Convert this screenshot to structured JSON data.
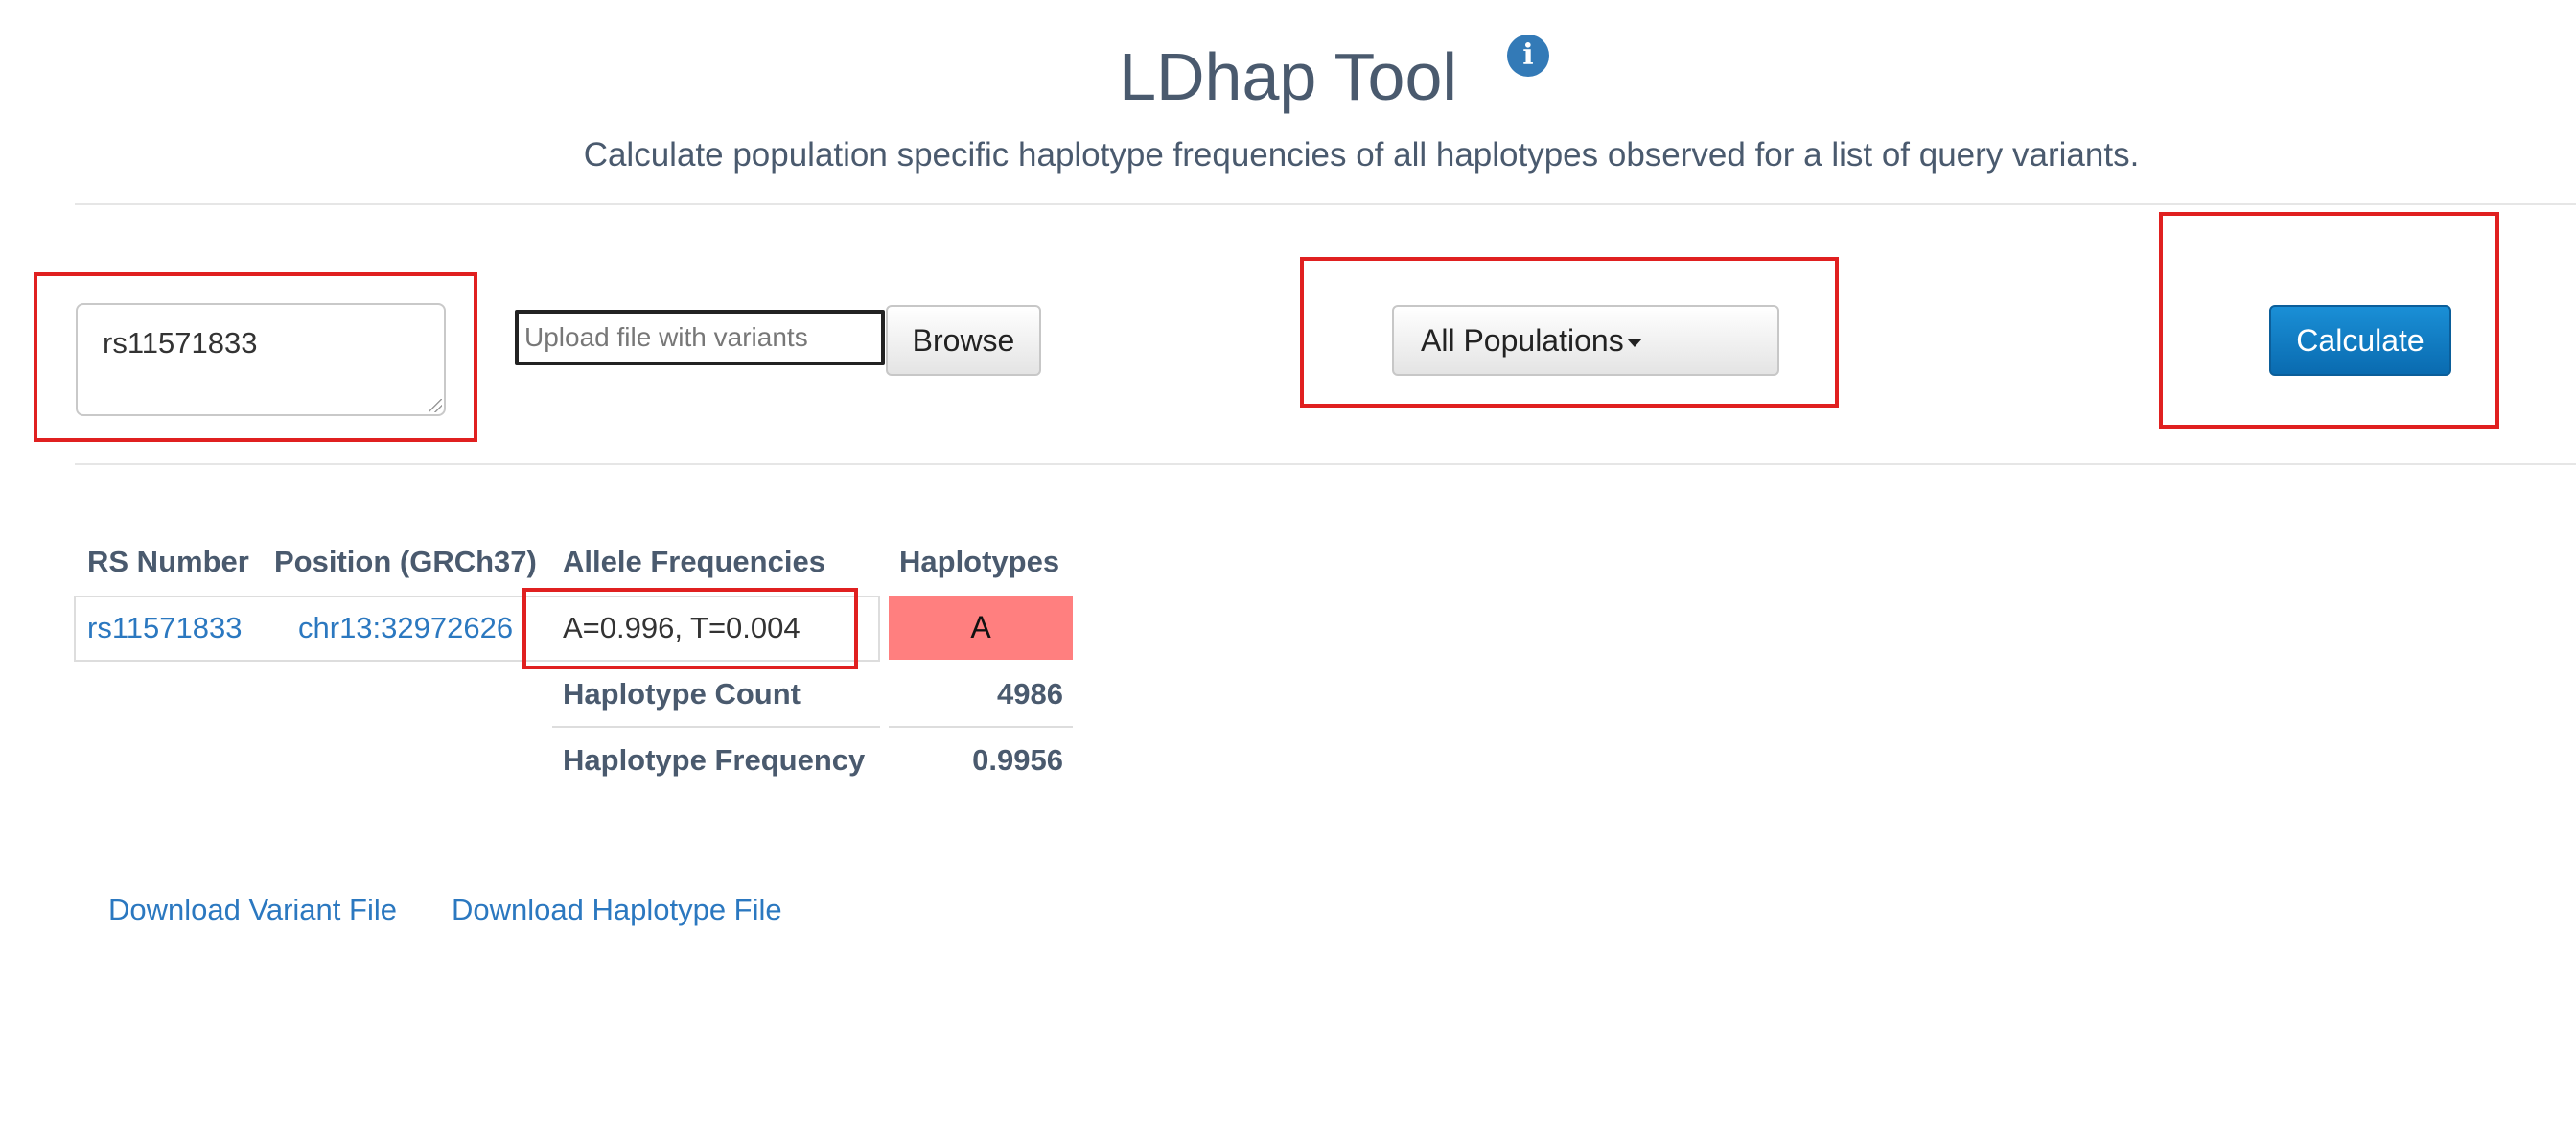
{
  "header": {
    "title": "LDhap Tool",
    "info_icon": "info-circle-icon",
    "subtitle": "Calculate population specific haplotype frequencies of all haplotypes observed for a list of query variants."
  },
  "form": {
    "snp_input_value": "rs11571833",
    "file_placeholder": "Upload file with variants",
    "browse_label": "Browse",
    "population_label": "All Populations",
    "calculate_label": "Calculate"
  },
  "results": {
    "headers": {
      "rs_number": "RS Number",
      "position": "Position (GRCh37)",
      "allele_frequencies": "Allele Frequencies",
      "haplotypes": "Haplotypes"
    },
    "variants": [
      {
        "rs": "rs11571833",
        "position": "chr13:32972626",
        "allele_freq": "A=0.996, T=0.004",
        "haplotype_allele": "A"
      }
    ],
    "summary": {
      "count_label": "Haplotype Count",
      "count_value": "4986",
      "freq_label": "Haplotype Frequency",
      "freq_value": "0.9956"
    }
  },
  "downloads": {
    "variant_file": "Download Variant File",
    "haplotype_file": "Download Haplotype File"
  },
  "colors": {
    "highlight_box": "#e02020",
    "haplotype_cell": "#ff7f7f",
    "calculate_button": "#0a6bb0",
    "link": "#2b78c0"
  }
}
